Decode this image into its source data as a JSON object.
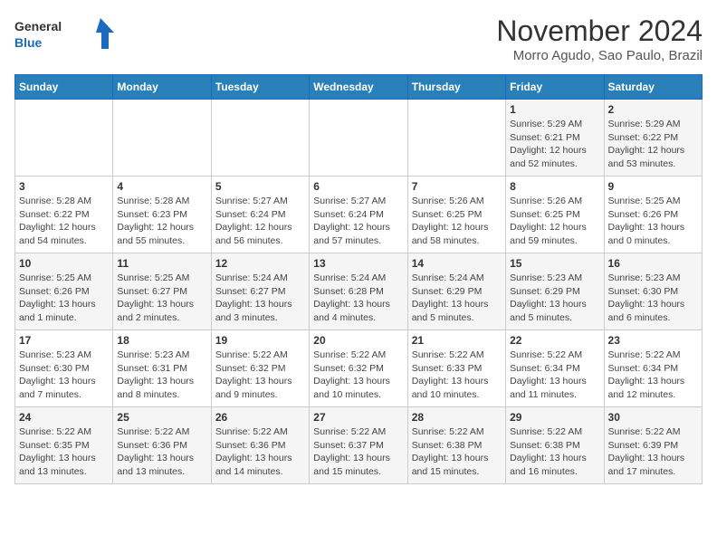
{
  "header": {
    "logo_general": "General",
    "logo_blue": "Blue",
    "month_title": "November 2024",
    "location": "Morro Agudo, Sao Paulo, Brazil"
  },
  "days_of_week": [
    "Sunday",
    "Monday",
    "Tuesday",
    "Wednesday",
    "Thursday",
    "Friday",
    "Saturday"
  ],
  "weeks": [
    [
      {
        "day": "",
        "info": ""
      },
      {
        "day": "",
        "info": ""
      },
      {
        "day": "",
        "info": ""
      },
      {
        "day": "",
        "info": ""
      },
      {
        "day": "",
        "info": ""
      },
      {
        "day": "1",
        "info": "Sunrise: 5:29 AM\nSunset: 6:21 PM\nDaylight: 12 hours and 52 minutes."
      },
      {
        "day": "2",
        "info": "Sunrise: 5:29 AM\nSunset: 6:22 PM\nDaylight: 12 hours and 53 minutes."
      }
    ],
    [
      {
        "day": "3",
        "info": "Sunrise: 5:28 AM\nSunset: 6:22 PM\nDaylight: 12 hours and 54 minutes."
      },
      {
        "day": "4",
        "info": "Sunrise: 5:28 AM\nSunset: 6:23 PM\nDaylight: 12 hours and 55 minutes."
      },
      {
        "day": "5",
        "info": "Sunrise: 5:27 AM\nSunset: 6:24 PM\nDaylight: 12 hours and 56 minutes."
      },
      {
        "day": "6",
        "info": "Sunrise: 5:27 AM\nSunset: 6:24 PM\nDaylight: 12 hours and 57 minutes."
      },
      {
        "day": "7",
        "info": "Sunrise: 5:26 AM\nSunset: 6:25 PM\nDaylight: 12 hours and 58 minutes."
      },
      {
        "day": "8",
        "info": "Sunrise: 5:26 AM\nSunset: 6:25 PM\nDaylight: 12 hours and 59 minutes."
      },
      {
        "day": "9",
        "info": "Sunrise: 5:25 AM\nSunset: 6:26 PM\nDaylight: 13 hours and 0 minutes."
      }
    ],
    [
      {
        "day": "10",
        "info": "Sunrise: 5:25 AM\nSunset: 6:26 PM\nDaylight: 13 hours and 1 minute."
      },
      {
        "day": "11",
        "info": "Sunrise: 5:25 AM\nSunset: 6:27 PM\nDaylight: 13 hours and 2 minutes."
      },
      {
        "day": "12",
        "info": "Sunrise: 5:24 AM\nSunset: 6:27 PM\nDaylight: 13 hours and 3 minutes."
      },
      {
        "day": "13",
        "info": "Sunrise: 5:24 AM\nSunset: 6:28 PM\nDaylight: 13 hours and 4 minutes."
      },
      {
        "day": "14",
        "info": "Sunrise: 5:24 AM\nSunset: 6:29 PM\nDaylight: 13 hours and 5 minutes."
      },
      {
        "day": "15",
        "info": "Sunrise: 5:23 AM\nSunset: 6:29 PM\nDaylight: 13 hours and 5 minutes."
      },
      {
        "day": "16",
        "info": "Sunrise: 5:23 AM\nSunset: 6:30 PM\nDaylight: 13 hours and 6 minutes."
      }
    ],
    [
      {
        "day": "17",
        "info": "Sunrise: 5:23 AM\nSunset: 6:30 PM\nDaylight: 13 hours and 7 minutes."
      },
      {
        "day": "18",
        "info": "Sunrise: 5:23 AM\nSunset: 6:31 PM\nDaylight: 13 hours and 8 minutes."
      },
      {
        "day": "19",
        "info": "Sunrise: 5:22 AM\nSunset: 6:32 PM\nDaylight: 13 hours and 9 minutes."
      },
      {
        "day": "20",
        "info": "Sunrise: 5:22 AM\nSunset: 6:32 PM\nDaylight: 13 hours and 10 minutes."
      },
      {
        "day": "21",
        "info": "Sunrise: 5:22 AM\nSunset: 6:33 PM\nDaylight: 13 hours and 10 minutes."
      },
      {
        "day": "22",
        "info": "Sunrise: 5:22 AM\nSunset: 6:34 PM\nDaylight: 13 hours and 11 minutes."
      },
      {
        "day": "23",
        "info": "Sunrise: 5:22 AM\nSunset: 6:34 PM\nDaylight: 13 hours and 12 minutes."
      }
    ],
    [
      {
        "day": "24",
        "info": "Sunrise: 5:22 AM\nSunset: 6:35 PM\nDaylight: 13 hours and 13 minutes."
      },
      {
        "day": "25",
        "info": "Sunrise: 5:22 AM\nSunset: 6:36 PM\nDaylight: 13 hours and 13 minutes."
      },
      {
        "day": "26",
        "info": "Sunrise: 5:22 AM\nSunset: 6:36 PM\nDaylight: 13 hours and 14 minutes."
      },
      {
        "day": "27",
        "info": "Sunrise: 5:22 AM\nSunset: 6:37 PM\nDaylight: 13 hours and 15 minutes."
      },
      {
        "day": "28",
        "info": "Sunrise: 5:22 AM\nSunset: 6:38 PM\nDaylight: 13 hours and 15 minutes."
      },
      {
        "day": "29",
        "info": "Sunrise: 5:22 AM\nSunset: 6:38 PM\nDaylight: 13 hours and 16 minutes."
      },
      {
        "day": "30",
        "info": "Sunrise: 5:22 AM\nSunset: 6:39 PM\nDaylight: 13 hours and 17 minutes."
      }
    ]
  ]
}
